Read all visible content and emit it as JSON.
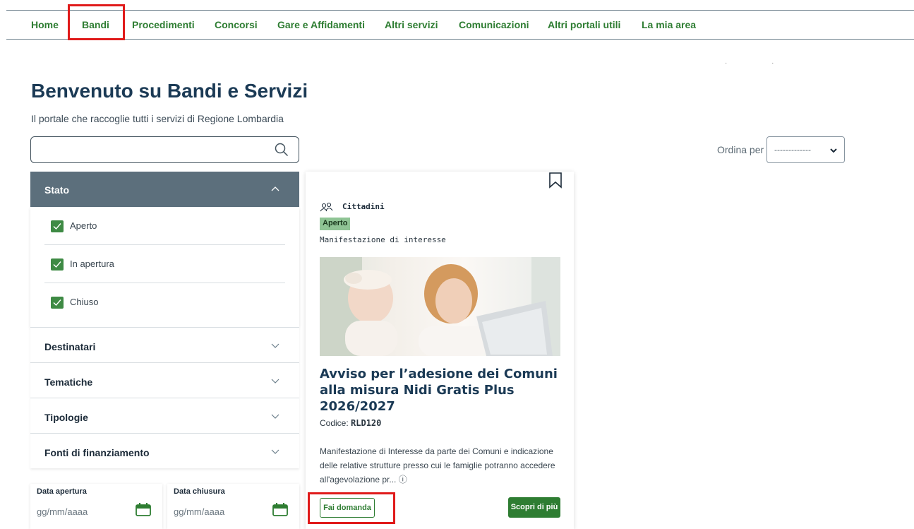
{
  "nav": {
    "items": [
      {
        "label": "Home"
      },
      {
        "label": "Bandi"
      },
      {
        "label": "Procedimenti"
      },
      {
        "label": "Concorsi"
      },
      {
        "label": "Gare e Affidamenti"
      },
      {
        "label": "Altri servizi"
      },
      {
        "label": "Comunicazioni"
      },
      {
        "label": "Altri portali utili"
      },
      {
        "label": "La mia area"
      }
    ],
    "active": "Bandi"
  },
  "header": {
    "title": "Benvenuto su Bandi e Servizi",
    "subtitle": "Il portale che raccoglie tutti i servizi di Regione Lombardia"
  },
  "search": {
    "value": "",
    "placeholder": ""
  },
  "sort": {
    "label": "Ordina per",
    "selected": "-------------"
  },
  "filters": {
    "stato": {
      "label": "Stato",
      "options": [
        {
          "label": "Aperto",
          "checked": true
        },
        {
          "label": "In apertura",
          "checked": true
        },
        {
          "label": "Chiuso",
          "checked": true
        }
      ]
    },
    "collapsed": [
      {
        "label": "Destinatari"
      },
      {
        "label": "Tematiche"
      },
      {
        "label": "Tipologie"
      },
      {
        "label": "Fonti di finanziamento"
      }
    ],
    "date_from": {
      "label": "Data apertura",
      "placeholder": "gg/mm/aaaa"
    },
    "date_to": {
      "label": "Data chiusura",
      "placeholder": "gg/mm/aaaa"
    }
  },
  "card": {
    "category": "Cittadini",
    "status": "Aperto",
    "type": "Manifestazione di interesse",
    "title": "Avviso per l’adesione dei Comuni alla misura Nidi Gratis Plus 2026/2027",
    "code_label": "Codice:",
    "code_value": "RLD120",
    "description": "Manifestazione di Interesse da parte dei Comuni e indicazione delle relative strutture presso cui le famiglie potranno accedere all'agevolazione pr...",
    "info_icon": "ⓘ",
    "apply_label": "Fai domanda",
    "more_label": "Scopri di più"
  },
  "colors": {
    "accent": "#2e7d32",
    "title": "#1b3a55",
    "filter_header": "#5c6f7c",
    "status_badge": "#8fc495",
    "highlight": "#e01b1b"
  }
}
